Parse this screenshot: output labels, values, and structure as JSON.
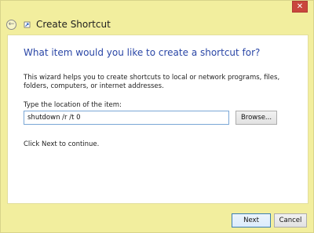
{
  "window": {
    "title": "Create Shortcut",
    "close_glyph": "✕",
    "back_glyph": "←"
  },
  "content": {
    "heading": "What item would you like to create a shortcut for?",
    "description": "This wizard helps you to create shortcuts to local or network programs, files, folders, computers, or internet addresses.",
    "field_label": "Type the location of the item:",
    "location_value": "shutdown /r /t 0",
    "browse_label": "Browse...",
    "hint": "Click Next to continue."
  },
  "footer": {
    "next_label": "Next",
    "cancel_label": "Cancel"
  },
  "colors": {
    "background": "#f2ee9e",
    "heading": "#2a46a6",
    "close": "#c9463d"
  },
  "icons": {
    "back": "back-arrow-icon",
    "wizard": "shortcut-wizard-icon",
    "close": "close-icon"
  }
}
